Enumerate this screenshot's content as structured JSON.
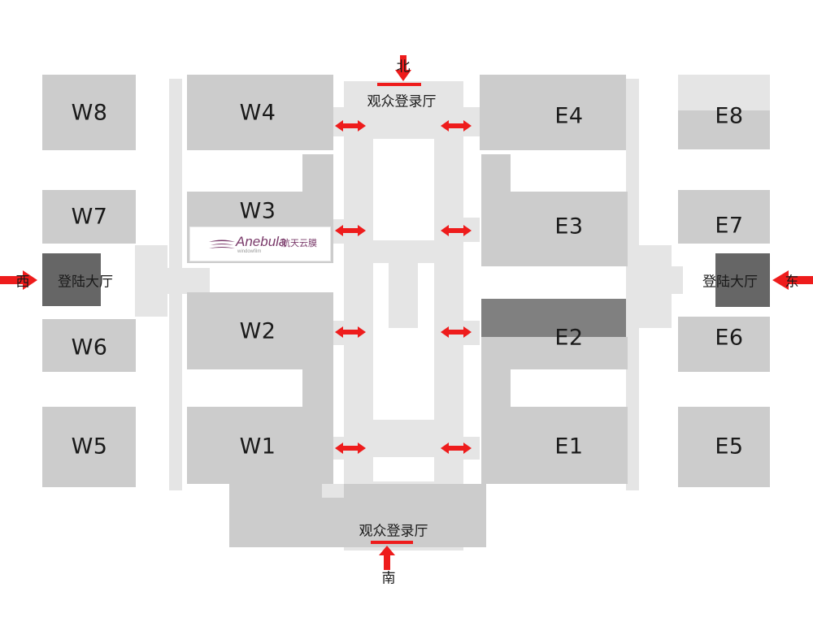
{
  "map": {
    "halls": {
      "w8": "W8",
      "w7": "W7",
      "w6": "W6",
      "w5": "W5",
      "w4": "W4",
      "w3": "W3",
      "w2": "W2",
      "w1": "W1",
      "e4": "E4",
      "e3": "E3",
      "e2": "E2",
      "e1": "E1",
      "e8": "E8",
      "e7": "E7",
      "e6": "E6",
      "e5": "E5"
    },
    "visitor_hall_north": "观众登录厅",
    "visitor_hall_south": "观众登录厅",
    "boarding_hall_west": "登陆大厅",
    "boarding_hall_east": "登陆大厅",
    "directions": {
      "north": "北",
      "south": "南",
      "west": "西",
      "east": "东"
    },
    "logo": {
      "word": "Anebula",
      "cn": "航天云膜",
      "sub": "windowfilm"
    },
    "colors": {
      "hall": "#cccccc",
      "corridor": "#e5e5e5",
      "lobby": "#666666",
      "arrow": "#ee1c1c"
    }
  }
}
